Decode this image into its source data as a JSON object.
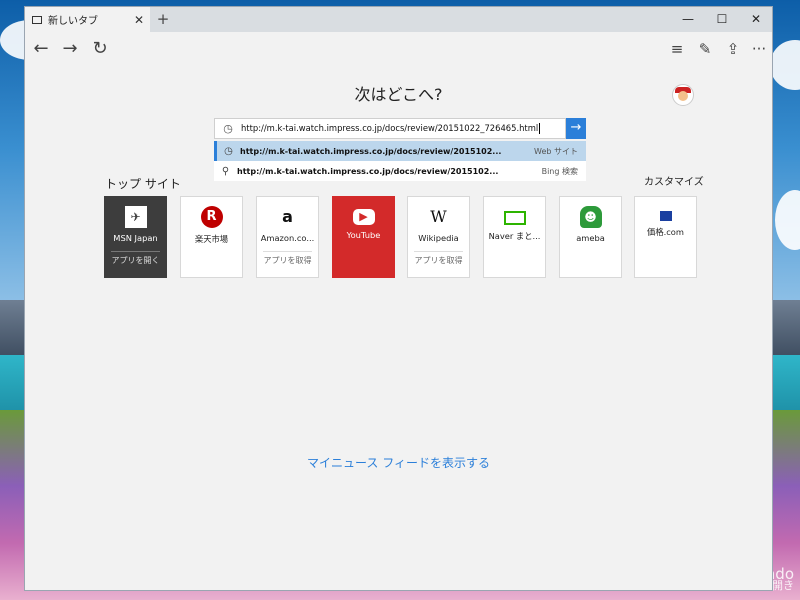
{
  "window": {
    "tab_title": "新しいタブ",
    "tab_close": "✕",
    "new_tab": "+"
  },
  "toolbar": {
    "back": "←",
    "forward": "→",
    "refresh": "↻",
    "hub": "≡",
    "note": "✎",
    "share": "⇪",
    "more": "···"
  },
  "controls": {
    "minimize": "—",
    "maximize": "☐",
    "close": "✕"
  },
  "main": {
    "heading": "次はどこへ?",
    "address_value": "http://m.k-tai.watch.impress.co.jp/docs/review/20151022_726465.html",
    "suggestions": [
      {
        "icon": "history-icon",
        "text": "http://m.k-tai.watch.impress.co.jp/docs/review/2015102...",
        "source": "Web サイト"
      },
      {
        "icon": "search-icon",
        "text": "http://m.k-tai.watch.impress.co.jp/docs/review/2015102...",
        "source": "Bing 検索"
      }
    ],
    "top_sites_title": "トップ サイト",
    "customize": "カスタマイズ",
    "tiles": [
      {
        "name": "MSN Japan",
        "action": "アプリを開く",
        "icon": "msn-icon"
      },
      {
        "name": "楽天市場",
        "icon": "rakuten-icon"
      },
      {
        "name": "Amazon.co...",
        "action": "アプリを取得",
        "icon": "amazon-icon"
      },
      {
        "name": "YouTube",
        "icon": "youtube-icon"
      },
      {
        "name": "Wikipedia",
        "action": "アプリを取得",
        "icon": "wikipedia-icon"
      },
      {
        "name": "Naver まと...",
        "icon": "naver-icon"
      },
      {
        "name": "ameba",
        "icon": "ameba-icon"
      },
      {
        "name": "価格.com",
        "icon": "kakaku-icon"
      }
    ],
    "news_link": "マイニュース フィードを表示する"
  },
  "watermark": {
    "line1": "Windo",
    "line2": "設定を開き"
  },
  "colors": {
    "accent": "#2b7fd9",
    "youtube": "#d32a2a",
    "tile_dark": "#3d3d3d"
  }
}
